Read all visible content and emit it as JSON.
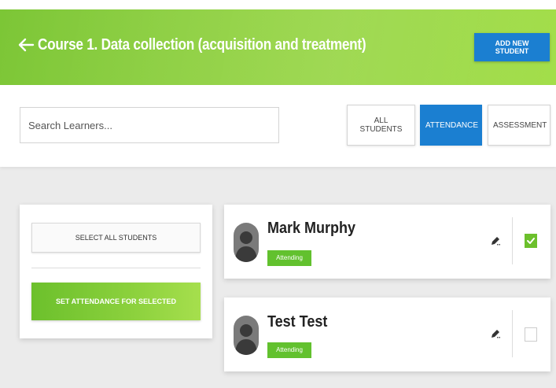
{
  "header": {
    "title": "Course 1. Data collection (acquisition and treatment)",
    "add_button": "ADD NEW STUDENT"
  },
  "search": {
    "placeholder": "Search Learners..."
  },
  "tabs": [
    {
      "label": "ALL STUDENTS",
      "active": false
    },
    {
      "label": "ATTENDANCE",
      "active": true
    },
    {
      "label": "ASSESSMENT",
      "active": false
    }
  ],
  "actions": {
    "select_all": "SELECT ALL STUDENTS",
    "set_attendance": "SET ATTENDANCE FOR SELECTED"
  },
  "students": [
    {
      "name": "Mark Murphy",
      "status": "Attending",
      "selected": true
    },
    {
      "name": "Test Test",
      "status": "Attending",
      "selected": false
    }
  ],
  "colors": {
    "green": "#7cc636",
    "blue": "#1b7fd1",
    "badge_green": "#62c12e"
  }
}
